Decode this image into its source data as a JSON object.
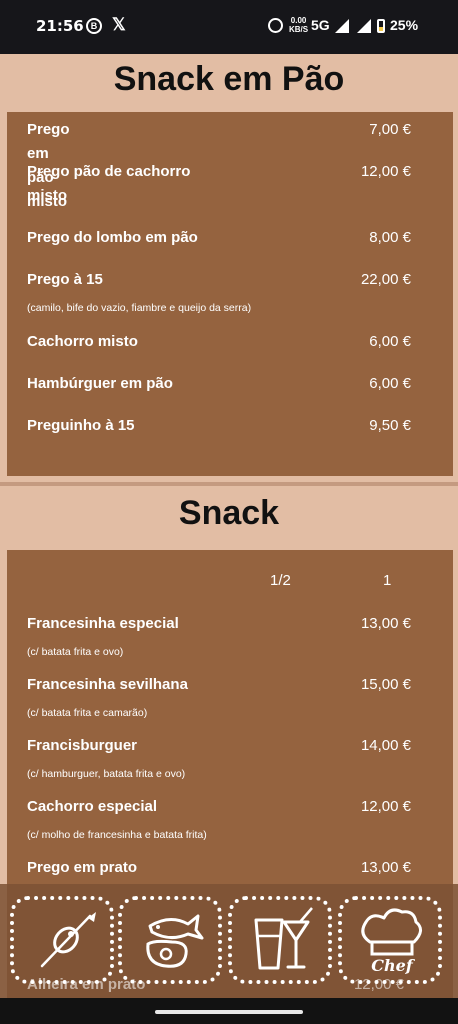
{
  "status_bar": {
    "time": "21:56",
    "b_icon_letter": "B",
    "x_icon_letter": "𝕏",
    "speed_value": "0.00",
    "speed_unit": "KB/S",
    "network": "5G",
    "battery": "25%"
  },
  "sections": [
    {
      "title": "Snack em Pão",
      "items": [
        {
          "name": "Prego em pão misto",
          "price": "7,00 €"
        },
        {
          "name": "Prego pão de cachorro misto",
          "name_line1": "Prego pão de cachorro",
          "name_line2": "misto",
          "price": "12,00 €"
        },
        {
          "name": "Prego do lombo em pão",
          "price": "8,00 €"
        },
        {
          "name": "Prego à 15",
          "price": "22,00 €",
          "description": "(camilo, bife do vazio, fiambre e queijo da serra)"
        },
        {
          "name": "Cachorro misto",
          "price": "6,00 €"
        },
        {
          "name": "Hambúrguer em pão",
          "price": "6,00 €"
        },
        {
          "name": "Preguinho à 15",
          "price": "9,50 €"
        }
      ]
    },
    {
      "title": "Snack",
      "columns": [
        "1/2",
        "1"
      ],
      "items": [
        {
          "name": "Francesinha especial",
          "price": "13,00 €",
          "description": "(c/ batata frita e ovo)"
        },
        {
          "name": "Francesinha sevilhana",
          "price": "15,00 €",
          "description": "(c/ batata frita e camarão)"
        },
        {
          "name": "Francisburguer",
          "price": "14,00 €",
          "description": "(c/ hamburguer, batata frita e ovo)"
        },
        {
          "name": "Cachorro especial",
          "price": "12,00 €",
          "description": "(c/ molho de francesinha e batata frita)"
        },
        {
          "name": "Prego em prato",
          "price": "13,00 €"
        },
        {
          "name": "Alheira em prato",
          "price": "12,00 €"
        }
      ]
    }
  ],
  "bottom_nav": {
    "buttons": [
      {
        "name": "snack-skewer",
        "icon": "olive-skewer-icon"
      },
      {
        "name": "meat-fish",
        "icon": "meat-fish-icon"
      },
      {
        "name": "drinks",
        "icon": "drinks-icon"
      },
      {
        "name": "chef",
        "icon": "chef-hat-icon",
        "label": "Chef"
      }
    ]
  },
  "colors": {
    "page_bg": "#e2bda4",
    "menu_bg": "#95633f",
    "overlay_bg": "#7d5234",
    "text_light": "#ffffff",
    "title_text": "#111111"
  }
}
